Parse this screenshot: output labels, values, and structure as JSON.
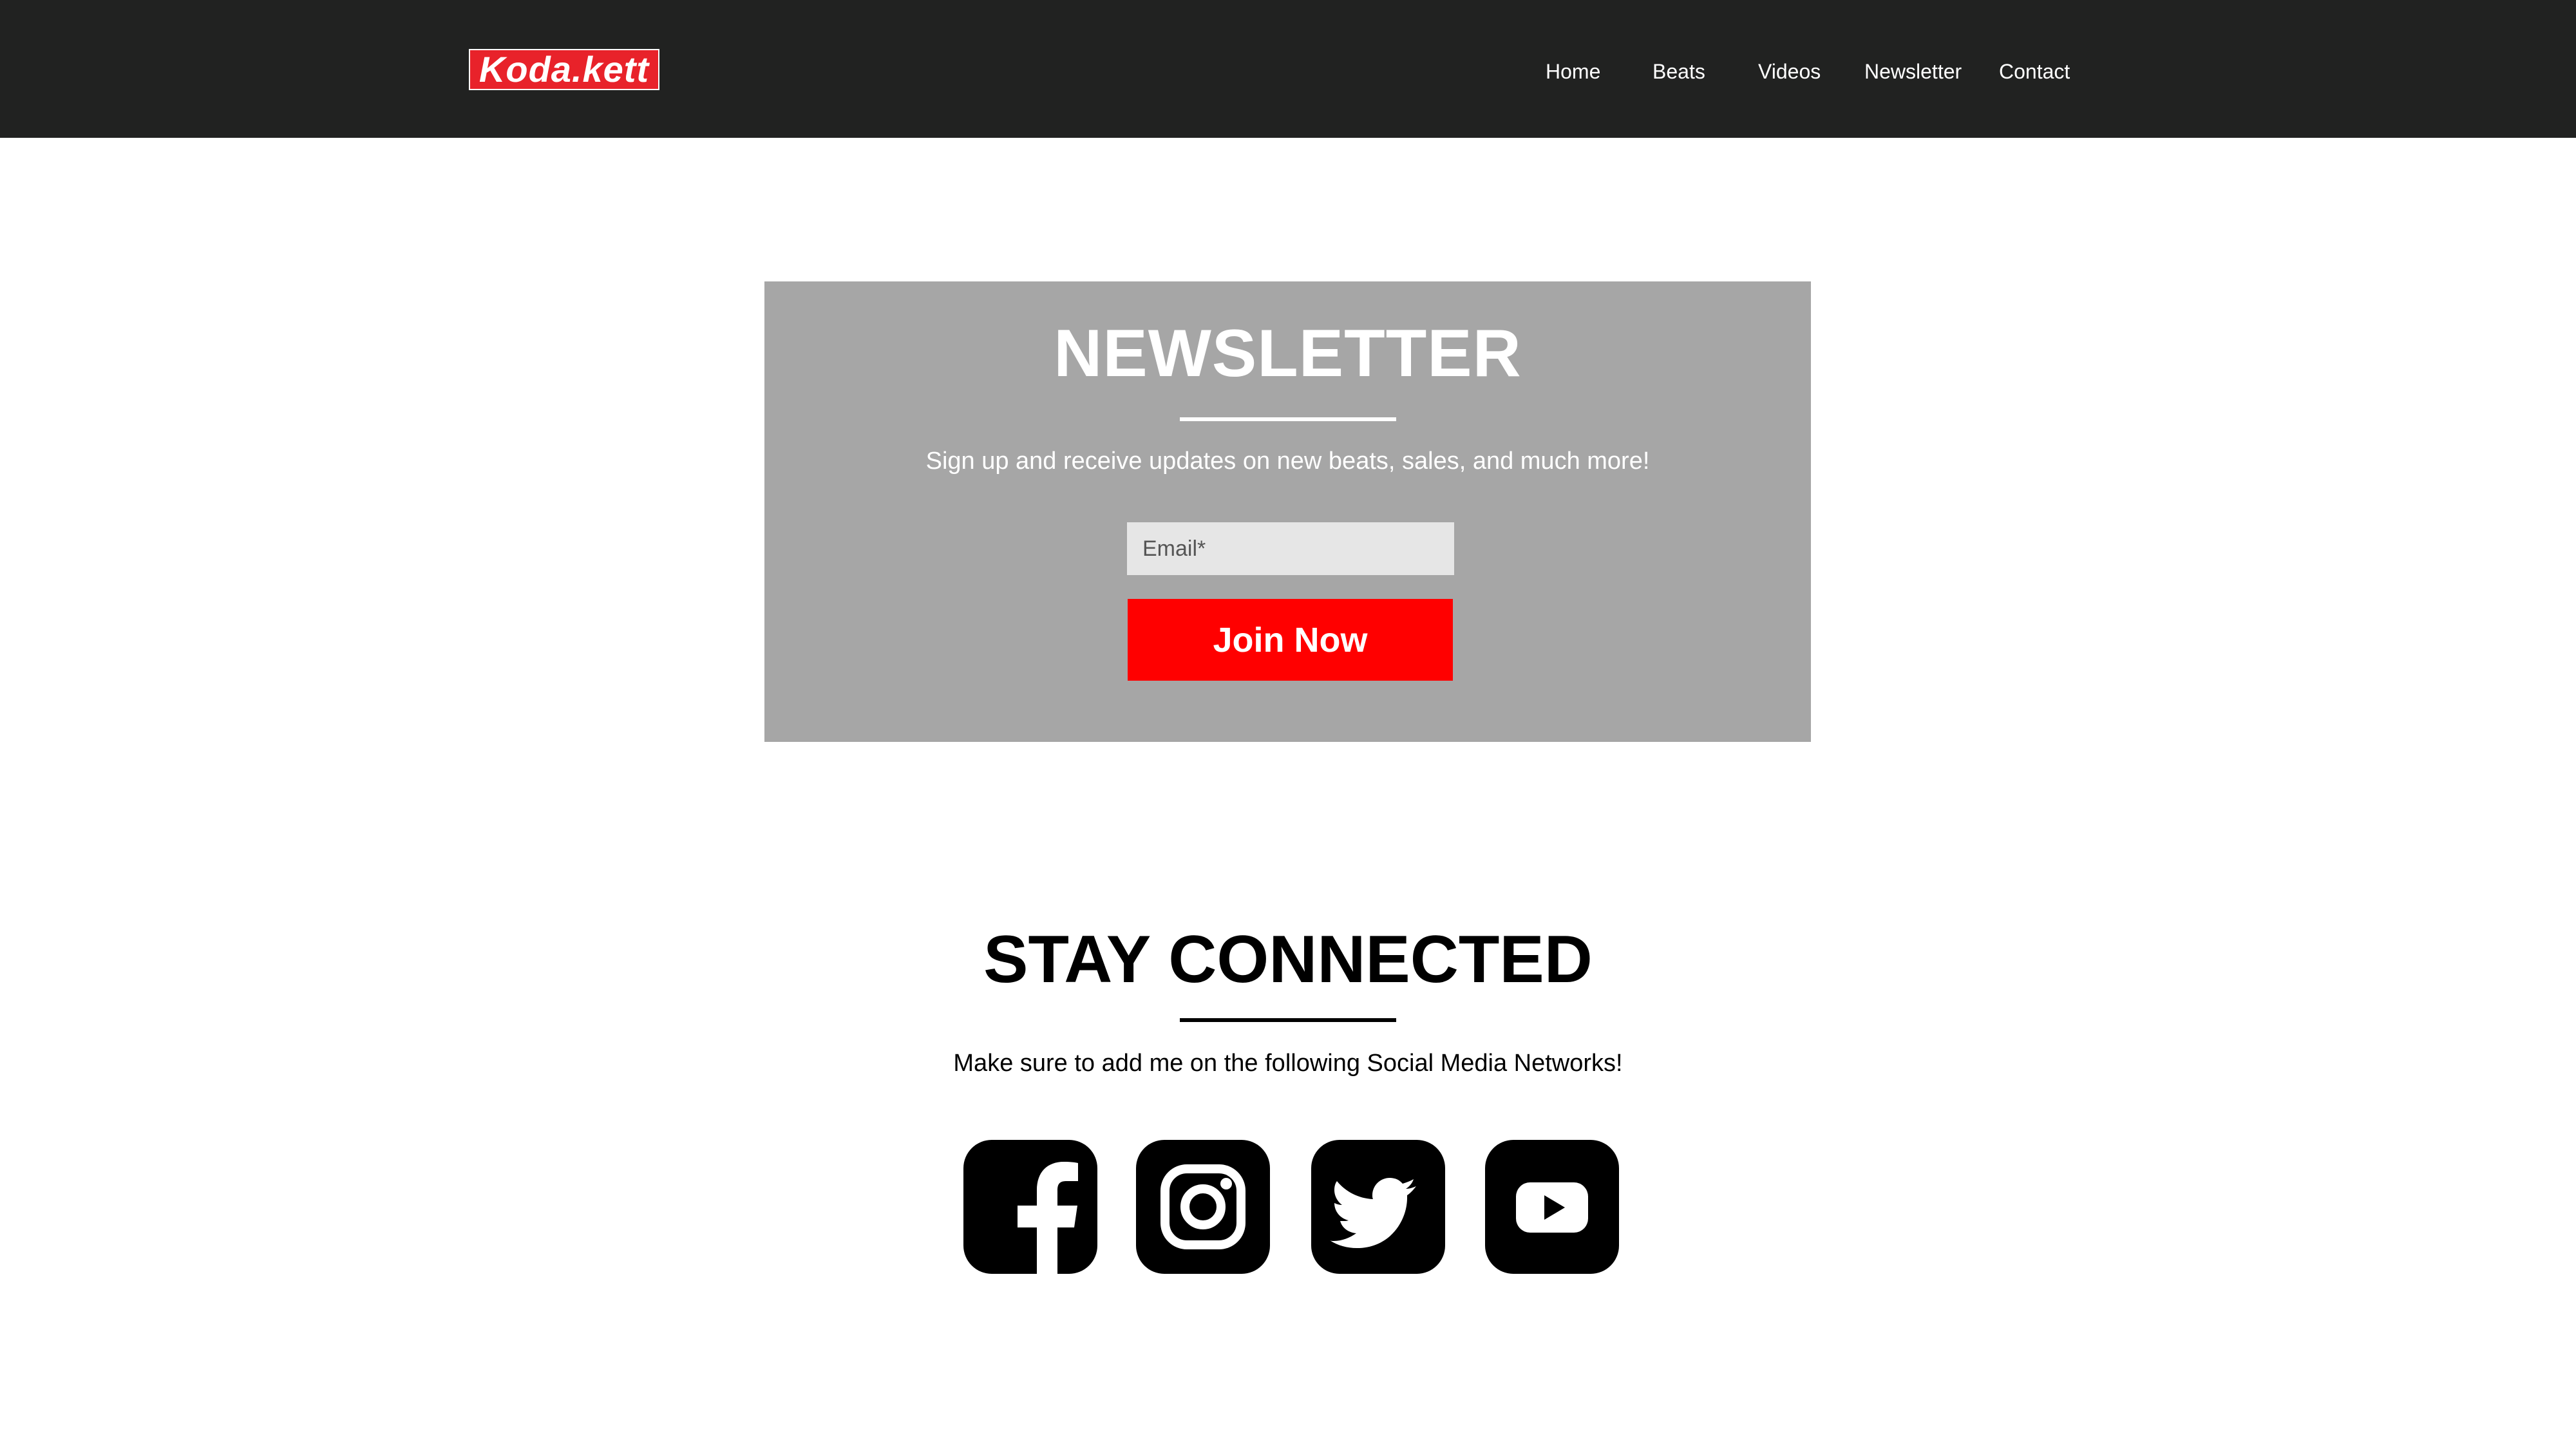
{
  "header": {
    "logo_text": "Koda.kett",
    "nav": {
      "home": "Home",
      "beats": "Beats",
      "videos": "Videos",
      "newsletter": "Newsletter",
      "contact": "Contact"
    }
  },
  "newsletter": {
    "title": "NEWSLETTER",
    "subtitle": "Sign up and receive updates on new beats, sales, and much more!",
    "email_placeholder": "Email*",
    "email_value": "",
    "join_label": "Join Now"
  },
  "social_section": {
    "title": "STAY CONNECTED",
    "subtitle": "Make sure to add me on the following Social Media Networks!",
    "icons": [
      "facebook-icon",
      "instagram-icon",
      "twitter-icon",
      "youtube-icon"
    ]
  },
  "colors": {
    "header_bg": "#212221",
    "logo_bg": "#e8222a",
    "newsletter_bg": "#a6a6a6",
    "join_button_bg": "#ff0000",
    "email_field_bg": "#e6e6e6"
  }
}
